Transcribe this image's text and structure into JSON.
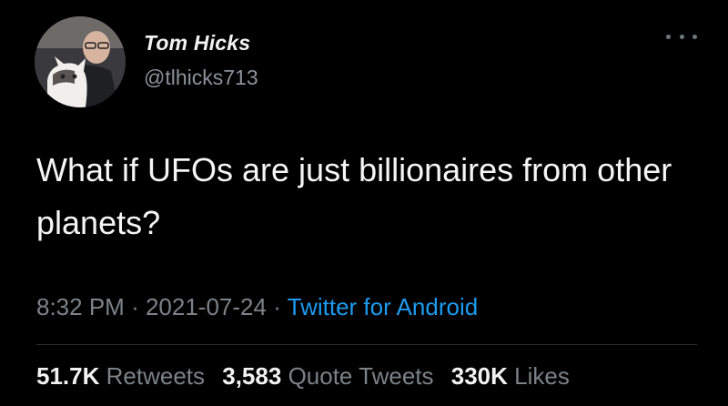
{
  "tweet": {
    "author_name": "Tom Hicks",
    "author_handle": "@tlhicks713",
    "more_icon": "more-horizontal-icon",
    "text": "What if UFOs are just billionaires from other planets?",
    "time": "8:32 PM",
    "separator": "·",
    "date": "2021-07-24",
    "source": "Twitter for Android",
    "retweets_count": "51.7K",
    "retweets_label": "Retweets",
    "quotes_count": "3,583",
    "quotes_label": "Quote Tweets",
    "likes_count": "330K",
    "likes_label": "Likes"
  },
  "colors": {
    "background": "#000000",
    "link": "#1d9bf0",
    "secondary_text": "#7c8287"
  }
}
